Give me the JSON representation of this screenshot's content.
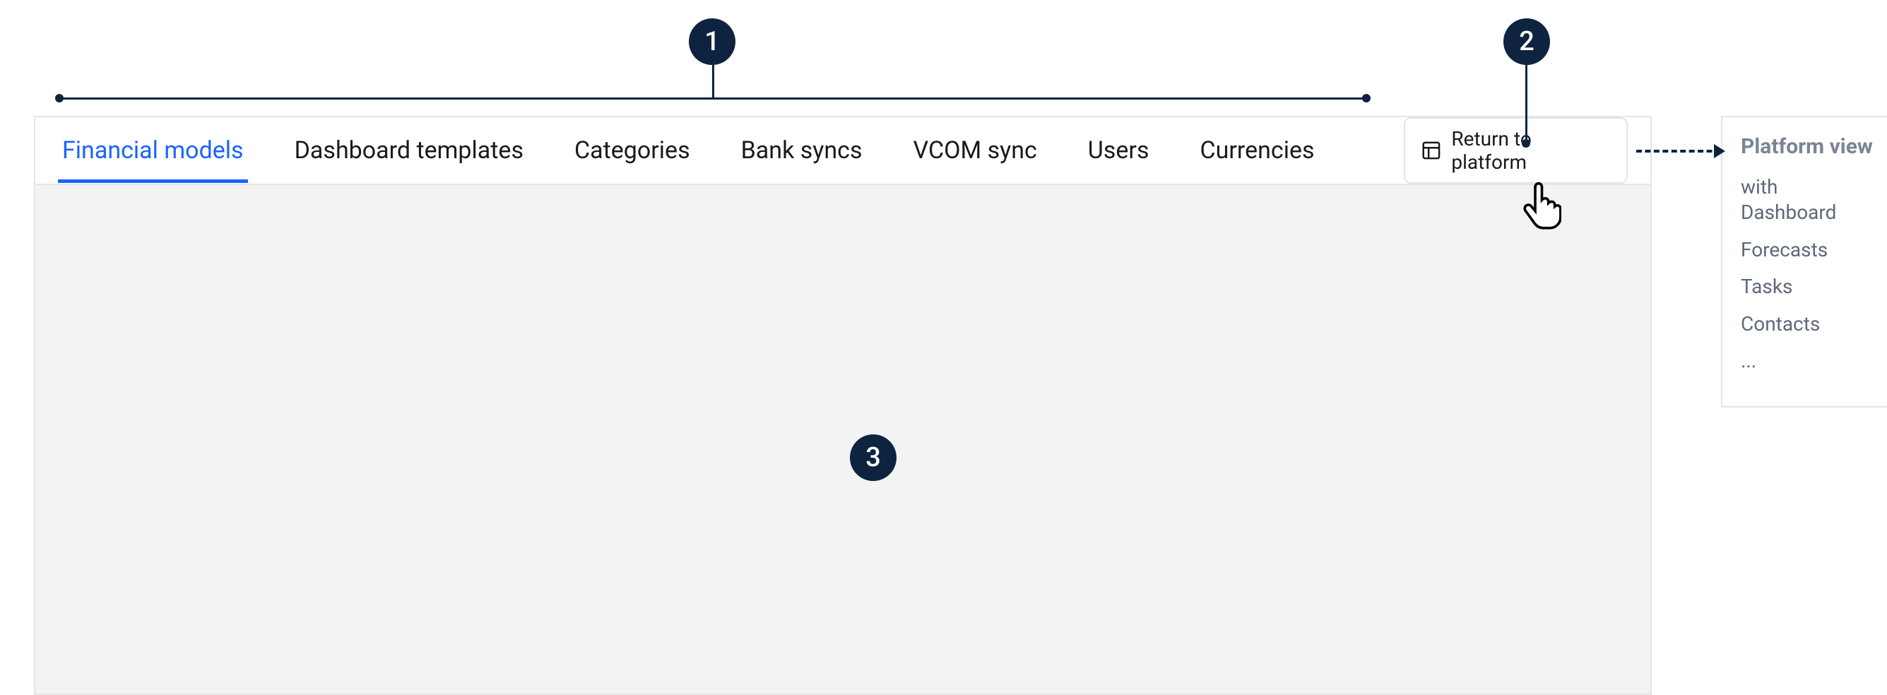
{
  "callouts": {
    "c1": "1",
    "c2": "2",
    "c3": "3"
  },
  "tabs": {
    "t0": "Financial models",
    "t1": "Dashboard templates",
    "t2": "Categories",
    "t3": "Bank syncs",
    "t4": "VCOM sync",
    "t5": "Users",
    "t6": "Currencies"
  },
  "return_button": {
    "label": "Return to platform"
  },
  "side_panel": {
    "title": "Platform view",
    "items": {
      "i0": "with Dashboard",
      "i1": "Forecasts",
      "i2": "Tasks",
      "i3": "Contacts",
      "i4": "..."
    }
  }
}
